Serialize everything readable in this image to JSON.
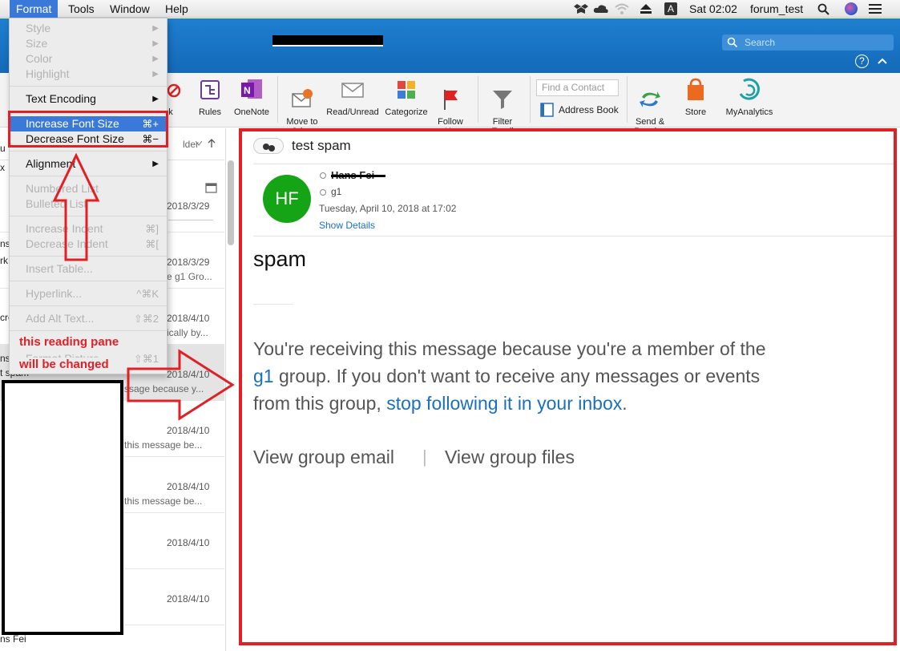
{
  "menubar": {
    "items": [
      "Format",
      "Tools",
      "Window",
      "Help"
    ],
    "clock": "Sat 02:02",
    "user": "forum_test",
    "input_indicator": "A"
  },
  "titlebar": {
    "search_placeholder": "Search",
    "help_label": "?"
  },
  "ribbon": {
    "items": [
      {
        "label": "nk",
        "icon": "junk-icon"
      },
      {
        "label": "Rules",
        "icon": "rules-icon"
      },
      {
        "label": "OneNote",
        "icon": "onenote-icon"
      },
      {
        "label": "Move to\nOther",
        "icon": "move-to-other-icon"
      },
      {
        "label": "Read/Unread",
        "icon": "envelope-icon"
      },
      {
        "label": "Categorize",
        "icon": "categorize-icon"
      },
      {
        "label": "Follow\nUp",
        "icon": "flag-icon"
      },
      {
        "label": "Filter\nEmail",
        "icon": "filter-icon"
      },
      {
        "label": "Send &\nReceive",
        "icon": "send-receive-icon"
      },
      {
        "label": "Store",
        "icon": "store-icon"
      },
      {
        "label": "MyAnalytics",
        "icon": "myanalytics-icon"
      }
    ],
    "find_contact_placeholder": "Find a Contact",
    "address_book": "Address Book"
  },
  "list": {
    "sort_label": "lder",
    "edge_labels": [
      "u",
      "x",
      "ns",
      "rk",
      "cro",
      "ns",
      "t spam",
      "ns Fei"
    ],
    "rows": [
      {
        "date": "2018/3/29",
        "preview": ""
      },
      {
        "date": "2018/3/29",
        "preview": "e g1 Gro..."
      },
      {
        "date": "2018/4/10",
        "preview": "ically by..."
      },
      {
        "date": "2018/4/10",
        "preview": "ssage because y..."
      },
      {
        "date": "2018/4/10",
        "preview": "this message be..."
      },
      {
        "date": "2018/4/10",
        "preview": "this message be..."
      },
      {
        "date": "2018/4/10",
        "preview": ""
      },
      {
        "date": "2018/4/10",
        "preview": ""
      }
    ]
  },
  "reading": {
    "subject": "test spam",
    "avatar_initials": "HF",
    "sender": "Hans Fei",
    "to": "g1",
    "timestamp": "Tuesday, April 10, 2018 at 17:02",
    "show_details": "Show Details",
    "body_title": "spam",
    "body_p1": "You're receiving this message because you're a member of the",
    "body_link_group": "g1",
    "body_p2": " group. If you don't want to receive any messages or events",
    "body_p3": "from this group, ",
    "body_link_unfollow": "stop following it in your inbox",
    "body_p3_end": ".",
    "view_group_email": "View group email",
    "divider": "|",
    "view_group_files": "View group files"
  },
  "format_menu": {
    "style": "Style",
    "size": "Size",
    "color": "Color",
    "highlight": "Highlight",
    "text_encoding": "Text Encoding",
    "increase_font": "Increase Font Size",
    "increase_sc": "⌘+",
    "decrease_font": "Decrease Font Size",
    "decrease_sc": "⌘−",
    "alignment": "Alignment",
    "numbered_list": "Numbered List",
    "bulleted_list": "Bulleted List",
    "increase_indent": "Increase Indent",
    "increase_indent_sc": "⌘]",
    "decrease_indent": "Decrease Indent",
    "decrease_indent_sc": "⌘[",
    "insert_table": "Insert Table...",
    "hyperlink": "Hyperlink...",
    "hyperlink_sc": "^⌘K",
    "add_alt_text": "Add Alt Text...",
    "add_alt_text_sc": "⇧⌘2",
    "format_picture": "Format Picture...",
    "format_picture_sc": "⇧⌘1"
  },
  "annotation": {
    "line1": "this reading pane",
    "line2": "will be changed"
  },
  "colors": {
    "accent": "#3b79d9",
    "titlebar": "#1a74c4",
    "annotation_red": "#e31f26",
    "avatar": "#15a415",
    "link": "#1a6fc0"
  }
}
